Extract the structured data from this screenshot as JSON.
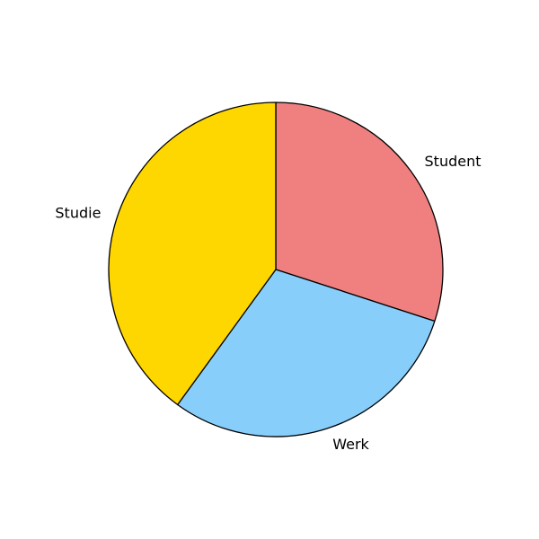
{
  "chart_data": {
    "type": "pie",
    "start_angle_deg": 90,
    "direction": "clockwise",
    "slices": [
      {
        "label": "Student",
        "value": 30,
        "color": "#F08080"
      },
      {
        "label": "Werk",
        "value": 30,
        "color": "#87CEFA"
      },
      {
        "label": "Studie",
        "value": 40,
        "color": "#FFD700"
      }
    ],
    "edge_color": "#000000"
  }
}
